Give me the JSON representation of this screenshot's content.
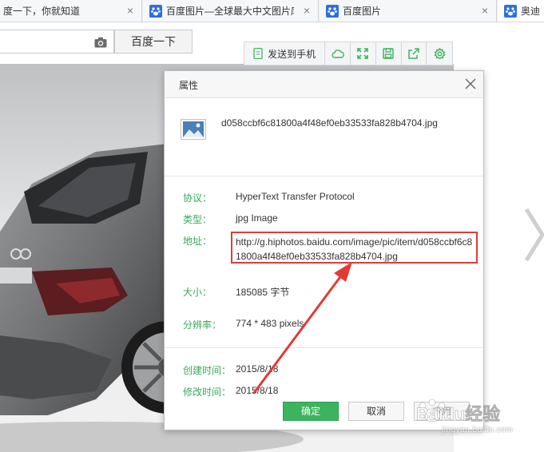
{
  "tabs": [
    {
      "label": "度一下，你就知道",
      "closable": true
    },
    {
      "label": "百度图片—全球最大中文图片库",
      "closable": true
    },
    {
      "label": "百度图片",
      "closable": true
    },
    {
      "label": "奥迪",
      "closable": false
    }
  ],
  "search": {
    "button_label": "百度一下"
  },
  "toolbar": {
    "send_label": "发送到手机"
  },
  "dialog": {
    "title": "属性",
    "filename": "d058ccbf6c81800a4f48ef0eb33533fa828b4704.jpg",
    "protocol_label": "协议：",
    "protocol_value": "HyperText Transfer Protocol",
    "type_label": "类型：",
    "type_value": "jpg Image",
    "address_label": "地址：",
    "address_value": "http://g.hiphotos.baidu.com/image/pic/item/d058ccbf6c81800a4f48ef0eb33533fa828b4704.jpg",
    "size_label": "大小：",
    "size_value": "185085 字节",
    "resolution_label": "分辨率：",
    "resolution_value": "774 * 483 pixels",
    "created_label": "创建时间：",
    "created_value": "2015/8/18",
    "modified_label": "修改时间：",
    "modified_value": "2015/8/18",
    "ok_label": "确定",
    "cancel_label": "取消",
    "apply_label": "应用"
  },
  "watermark": {
    "brand": "Baidu经验",
    "url": "jingyan.baidu.com"
  },
  "colors": {
    "accent": "#3bb55d",
    "label_green": "#3aa85a",
    "highlight_red": "#e23a3a"
  }
}
